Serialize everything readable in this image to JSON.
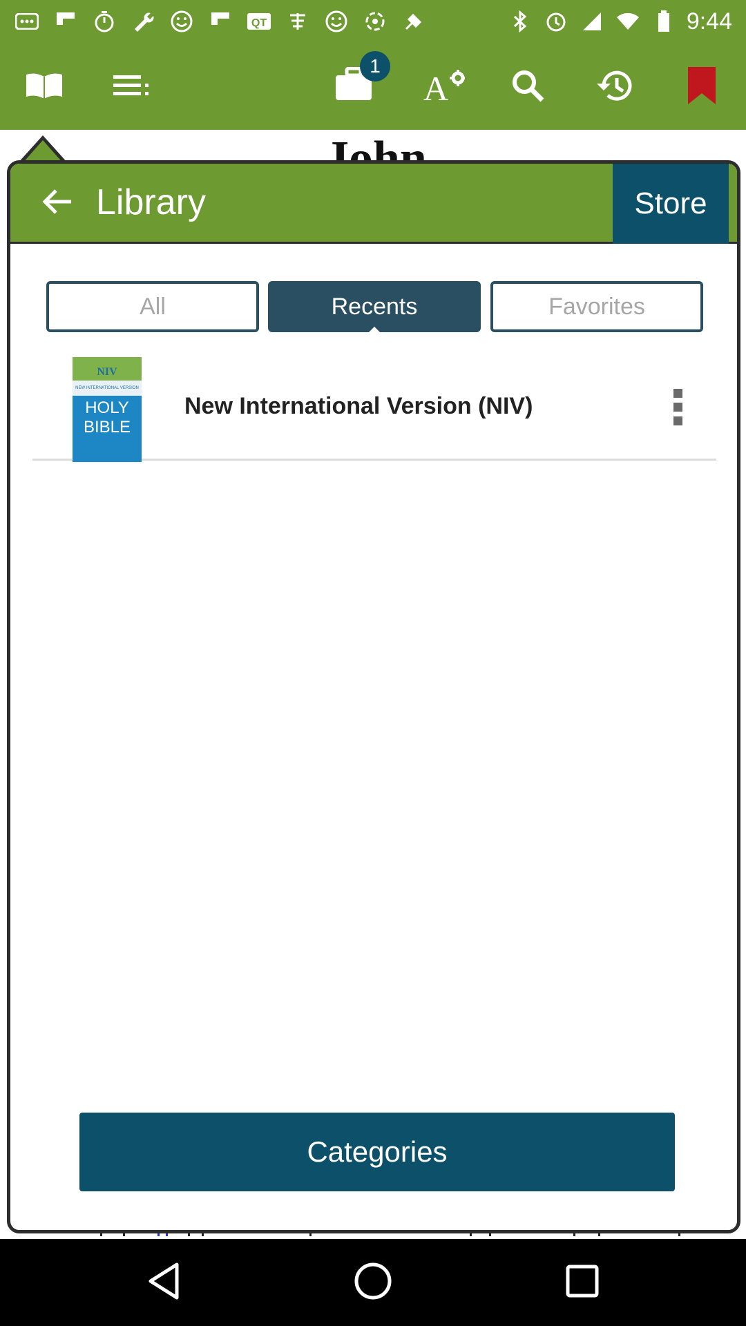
{
  "status_bar": {
    "time": "9:44",
    "left_icons": [
      "more-notifications-icon",
      "flipboard-icon",
      "timer-icon",
      "wrench-icon",
      "smiley-icon",
      "flipboard-icon",
      "qt-icon",
      "chinese-char-icon",
      "smiley-icon",
      "cycle-icon",
      "fake-gps-icon"
    ],
    "right_icons": [
      "bluetooth-icon",
      "alarm-icon",
      "signal-icon",
      "wifi-icon",
      "battery-icon"
    ]
  },
  "toolbar": {
    "badge_count": "1",
    "icons": [
      "book-icon",
      "list-icon",
      "briefcase-icon",
      "text-settings-icon",
      "search-icon",
      "history-icon",
      "bookmark-icon"
    ]
  },
  "background": {
    "title_fragment": "John"
  },
  "popup": {
    "title": "Library",
    "store_label": "Store",
    "tabs": [
      {
        "label": "All",
        "active": false
      },
      {
        "label": "Recents",
        "active": true
      },
      {
        "label": "Favorites",
        "active": false
      }
    ],
    "books": [
      {
        "title": "New International Version (NIV)",
        "cover_top": "NIV",
        "cover_sub": "NEW INTERNATIONAL VERSION",
        "cover_title_line1": "HOLY",
        "cover_title_line2": "BIBLE"
      }
    ],
    "categories_label": "Categories"
  },
  "colors": {
    "primary_green": "#6d9a31",
    "dark_teal": "#0d5069",
    "tab_blue": "#2a4f63",
    "bookmark_red": "#c0161e"
  }
}
